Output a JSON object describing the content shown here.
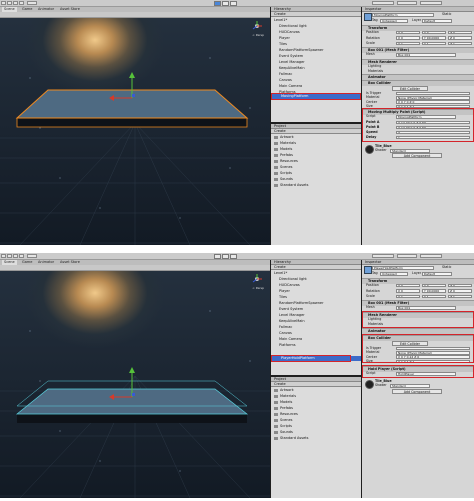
{
  "toolbar": {
    "play_icon": "play-icon",
    "pause_icon": "pause-icon",
    "step_icon": "step-icon"
  },
  "tabs": {
    "scene": "Scene",
    "game": "Game",
    "animator": "Animator",
    "asset_store": "Asset Store"
  },
  "gizmo": {
    "persp": "< Persp"
  },
  "hierarchy": {
    "title": "Hierarchy",
    "create": "Create",
    "items": [
      "Level1*",
      "Directional light",
      "HUDCanvas",
      "Player",
      "Tiles",
      "RandomPlatformSpawner",
      "Event System",
      "Level Manager",
      "KeepAliveMain",
      "Fallmac",
      "Canvas",
      "Main Camera",
      "Platforms"
    ]
  },
  "project": {
    "title": "Project",
    "create": "Create",
    "folders": [
      "Artwork",
      "Materials",
      "Models",
      "Prefabs",
      "Resources",
      "Scenes",
      "Scripts",
      "Sounds",
      "Standard Assets"
    ]
  },
  "top": {
    "selected_label": "MovingPlatform",
    "inspector": {
      "title": "Inspector",
      "object_name": "MovingPlatform",
      "tag_label": "Tag",
      "tag_value": "Untagged",
      "layer_label": "Layer",
      "layer_value": "Default",
      "static_label": "Static",
      "transform": {
        "header": "Transform",
        "rows": [
          {
            "label": "Position",
            "x": "X 0",
            "y": "Y 0",
            "z": "Z 0"
          },
          {
            "label": "Rotation",
            "x": "X 0",
            "y": "Y 90.0000",
            "z": "Z 0"
          },
          {
            "label": "Scale",
            "x": "X 1",
            "y": "Y 1",
            "z": "Z 1"
          }
        ]
      },
      "mesh_filter": {
        "header": "Box 001 (Mesh Filter)",
        "mesh_label": "Mesh",
        "mesh_value": "Box 001"
      },
      "mesh_renderer": {
        "header": "Mesh Renderer",
        "rows": [
          "Lighting",
          "Materials"
        ]
      },
      "animator": {
        "header": "Animator"
      },
      "box_collider": {
        "header": "Box Collider",
        "edit_label": "Edit Collider",
        "rows": [
          {
            "label": "Is Trigger",
            "value": ""
          },
          {
            "label": "Material",
            "value": "None (Physic Material)"
          },
          {
            "label": "Center",
            "value": "X 0   Y 0   Z 0"
          },
          {
            "label": "Size",
            "value": "X 1   Y 1   Z 1"
          }
        ]
      },
      "script": {
        "header": "Moving Multiply Point (Script)",
        "script_label": "Script",
        "script_value": "MovingPlatform",
        "rows": [
          {
            "label": "Point A",
            "value": "X 14.79   Y 0   Z 0.59"
          },
          {
            "label": "Point B",
            "value": "X 14.79   Y 0   Z 0.59"
          },
          {
            "label": "Speed",
            "value": "3"
          },
          {
            "label": "Delay",
            "value": "1"
          }
        ]
      },
      "material": {
        "name": "Tile_Blue",
        "shader_label": "Shader",
        "shader_value": "Standard"
      },
      "add_component": "Add Component"
    }
  },
  "bottom": {
    "selected_label": "PlayerHoldPlatform",
    "inspector": {
      "title": "Inspector",
      "object_name": "PlayerHoldPlatform",
      "tag_label": "Tag",
      "tag_value": "Untagged",
      "layer_label": "Layer",
      "layer_value": "Default",
      "static_label": "Static",
      "transform": {
        "header": "Transform",
        "rows": [
          {
            "label": "Position",
            "x": "X 0",
            "y": "Y 0",
            "z": "Z 0"
          },
          {
            "label": "Rotation",
            "x": "X 0",
            "y": "Y 90.0000",
            "z": "Z 0"
          },
          {
            "label": "Scale",
            "x": "X 1",
            "y": "Y 1",
            "z": "Z 1"
          }
        ]
      },
      "mesh_filter": {
        "header": "Box 001 (Mesh Filter)",
        "mesh_label": "Mesh",
        "mesh_value": "Box 001"
      },
      "mesh_renderer": {
        "header": "Mesh Renderer",
        "rows": [
          "Lighting",
          "Materials"
        ]
      },
      "animator": {
        "header": "Animator"
      },
      "box_collider": {
        "header": "Box Collider",
        "edit_label": "Edit Collider",
        "rows": [
          {
            "label": "Is Trigger",
            "value": ""
          },
          {
            "label": "Material",
            "value": "None (Physic Material)"
          },
          {
            "label": "Center",
            "value": "X 0   Y 0.12   Z 0"
          },
          {
            "label": "Size",
            "value": "X 1   Y 1   Z 1"
          }
        ]
      },
      "script": {
        "header": "Hold Player (Script)",
        "script_label": "Script",
        "script_value": "HoldPlayer"
      },
      "material": {
        "name": "Tile_Blue",
        "shader_label": "Shader",
        "shader_value": "Standard"
      },
      "add_component": "Add Component"
    }
  },
  "colors": {
    "highlight_red": "#d4242a",
    "selection_blue": "#3d6bc9",
    "platform_outline_top": "#f08a1f",
    "platform_outline_bottom": "#5ad2e0"
  }
}
